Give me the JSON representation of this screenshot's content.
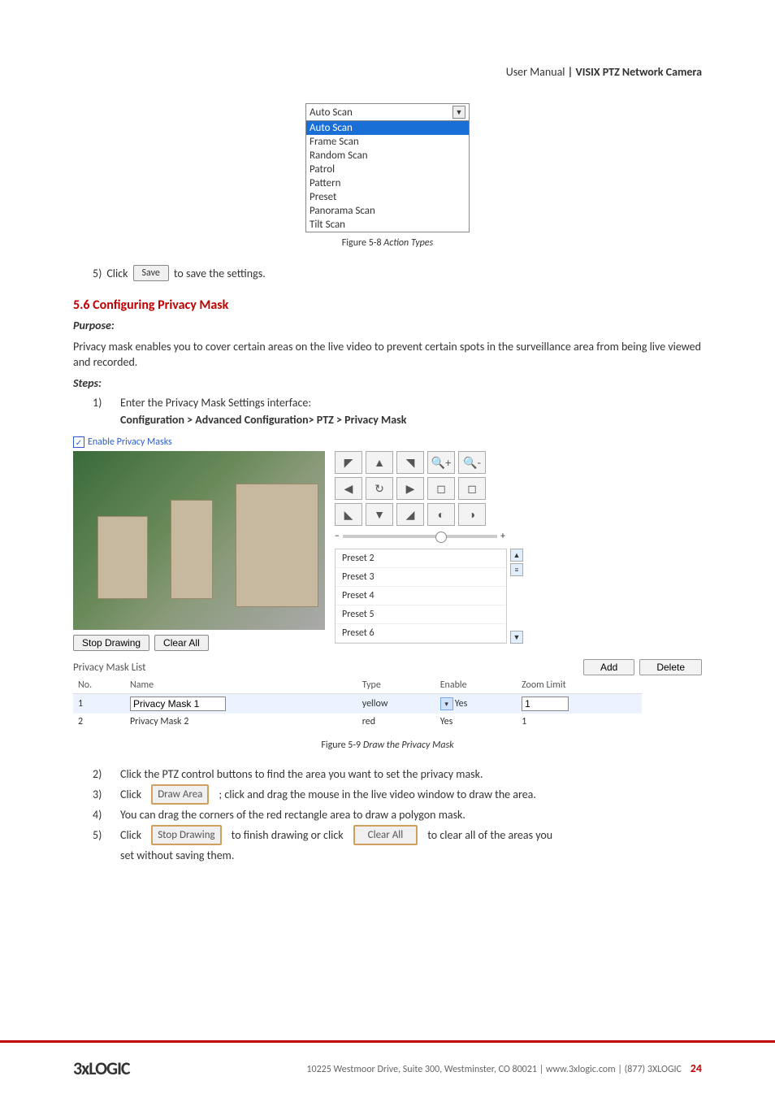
{
  "header": {
    "light": "User Manual ",
    "bold": "| VISIX PTZ Network Camera"
  },
  "dropdown": {
    "selected_top": "Auto Scan",
    "highlighted": "Auto Scan",
    "items": [
      "Frame Scan",
      "Random Scan",
      "Patrol",
      "Pattern",
      "Preset",
      "Panorama Scan",
      "Tilt Scan"
    ]
  },
  "caption1": {
    "prefix": "Figure 5-8",
    "title": " Action Types"
  },
  "step5a": {
    "num": "5)",
    "pre": "Click",
    "btn": "Save",
    "post": "to save the settings."
  },
  "section": {
    "number": "5.6",
    "title": " Configuring Privacy Mask"
  },
  "purpose_label": "Purpose:",
  "purpose_text": "Privacy mask enables you to cover certain areas on the live video to prevent certain spots in the surveillance area from being live viewed and recorded.",
  "steps_label": "Steps:",
  "step1": {
    "num": "1)",
    "text": "Enter the Privacy Mask Settings interface:"
  },
  "breadcrumb": "Configuration > Advanced Configuration> PTZ > Privacy Mask",
  "checkbox_label": "Enable Privacy Masks",
  "presets": [
    "Preset 2",
    "Preset 3",
    "Preset 4",
    "Preset 5",
    "Preset 6"
  ],
  "below_video": {
    "stop": "Stop Drawing",
    "clear": "Clear All"
  },
  "list": {
    "title": "Privacy Mask List",
    "add": "Add",
    "delete": "Delete",
    "headers": {
      "no": "No.",
      "name": "Name",
      "type": "Type",
      "enable": "Enable",
      "zoom": "Zoom Limit"
    },
    "rows": [
      {
        "no": "1",
        "name": "Privacy Mask 1",
        "type": "yellow",
        "enable": "Yes",
        "zoom": "1",
        "selected": true
      },
      {
        "no": "2",
        "name": "Privacy Mask 2",
        "type": "red",
        "enable": "Yes",
        "zoom": "1",
        "selected": false
      }
    ]
  },
  "caption2": {
    "prefix": "Figure 5-9",
    "title": " Draw the Privacy Mask"
  },
  "step2": {
    "num": "2)",
    "text": "Click the PTZ control buttons to find the area you want to set the privacy mask."
  },
  "step3": {
    "num": "3)",
    "pre": "Click",
    "btn": "Draw Area",
    "post": "; click and drag the mouse in the live video window to draw the area."
  },
  "step4": {
    "num": "4)",
    "text": "You can drag the corners of the red rectangle area to draw a polygon mask."
  },
  "step5b": {
    "num": "5)",
    "pre": "Click",
    "btn1": "Stop Drawing",
    "mid": "to finish drawing or click",
    "btn2": "Clear All",
    "post": "to clear all of the areas you",
    "line2": "set without saving them."
  },
  "footer": {
    "logo": "3xLOGIC",
    "text": "10225 Westmoor Drive, Suite 300, Westminster, CO 80021 | www.3xlogic.com | (877) 3XLOGIC",
    "page": "24"
  }
}
